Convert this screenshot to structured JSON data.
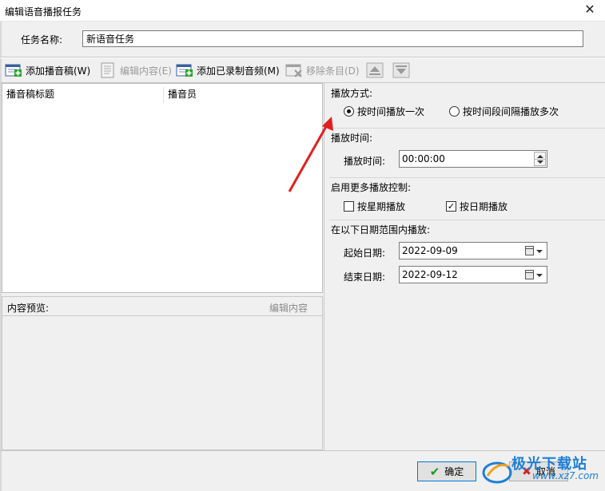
{
  "window": {
    "title": "编辑语音播报任务",
    "close_glyph": "✕"
  },
  "task": {
    "name_label": "任务名称:",
    "name_value": "新语音任务"
  },
  "toolbar": {
    "add_script": "添加播音稿(W)",
    "edit_content": "编辑内容(E)",
    "add_recorded": "添加已录制音频(M)",
    "remove_item": "移除条目(D)"
  },
  "list": {
    "col_title": "播音稿标题",
    "col_announcer": "播音员"
  },
  "preview": {
    "label": "内容预览:",
    "edit_link": "编辑内容"
  },
  "playback": {
    "mode_title": "播放方式:",
    "mode_once": "按时间播放一次",
    "mode_interval": "按时间段间隔播放多次",
    "mode_selected": "once",
    "time_title": "播放时间:",
    "time_label": "播放时间:",
    "time_value": "00:00:00",
    "more_title": "启用更多播放控制:",
    "by_week": "按星期播放",
    "by_week_checked": false,
    "by_date": "按日期播放",
    "by_date_checked": true,
    "range_title": "在以下日期范围内播放:",
    "start_label": "起始日期:",
    "start_value": "2022-09-09",
    "end_label": "结束日期:",
    "end_value": "2022-09-12"
  },
  "footer": {
    "ok": "确定",
    "cancel": "取消"
  },
  "watermark": {
    "brand": "极光下载站",
    "site": "www.xz7.com"
  },
  "colors": {
    "annotation_arrow": "#e02020",
    "ok_icon": "#1a9a1a",
    "cancel_icon": "#d62020",
    "accent": "#0078d7",
    "watermark": "#1e7fd6"
  },
  "icons": {
    "add_script": "add-document-icon",
    "edit_content": "document-edit-icon",
    "add_recorded": "add-audio-icon",
    "remove_item": "remove-item-icon",
    "move_up": "move-up-icon",
    "move_down": "move-down-icon",
    "ok": "checkmark-icon",
    "cancel": "cross-icon"
  }
}
